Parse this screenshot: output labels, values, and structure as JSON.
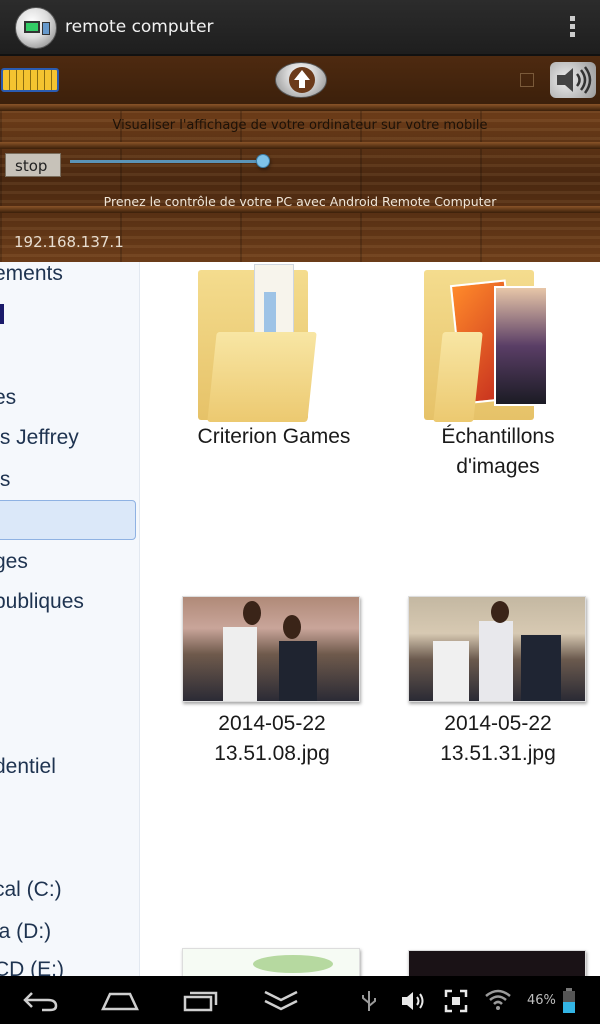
{
  "app": {
    "title": "remote computer"
  },
  "panel": {
    "subtitle1": "Visualiser l'affichage de votre ordinateur sur votre mobile",
    "stop_label": "stop",
    "subtitle2": "Prenez le contrôle de votre PC avec Android Remote Computer",
    "ip": "192.168.137.1",
    "slider_level": 0.95
  },
  "sidebar": {
    "items": [
      "ements",
      "I",
      "es",
      "ts Jeffrey",
      "ts",
      "",
      "ges",
      "publiques",
      "dentiel",
      "cal (C:)",
      "ia (D:)",
      "CD (E:)"
    ]
  },
  "files": {
    "folders": [
      {
        "label_line1": "Criterion Games",
        "label_line2": ""
      },
      {
        "label_line1": "Échantillons",
        "label_line2": "d'images"
      }
    ],
    "images": [
      {
        "label_line1": "2014-05-22",
        "label_line2": "13.51.08.jpg"
      },
      {
        "label_line1": "2014-05-22",
        "label_line2": "13.51.31.jpg"
      }
    ]
  },
  "statusbar": {
    "battery": "46%"
  },
  "icons": [
    "app-icon",
    "overflow-menu-icon",
    "keyboard-icon",
    "upload-icon",
    "speaker-icon",
    "back-icon",
    "home-icon",
    "recents-icon",
    "hide-keyboard-icon",
    "usb-icon",
    "volume-icon",
    "screenshot-icon",
    "wifi-icon",
    "battery-icon"
  ]
}
